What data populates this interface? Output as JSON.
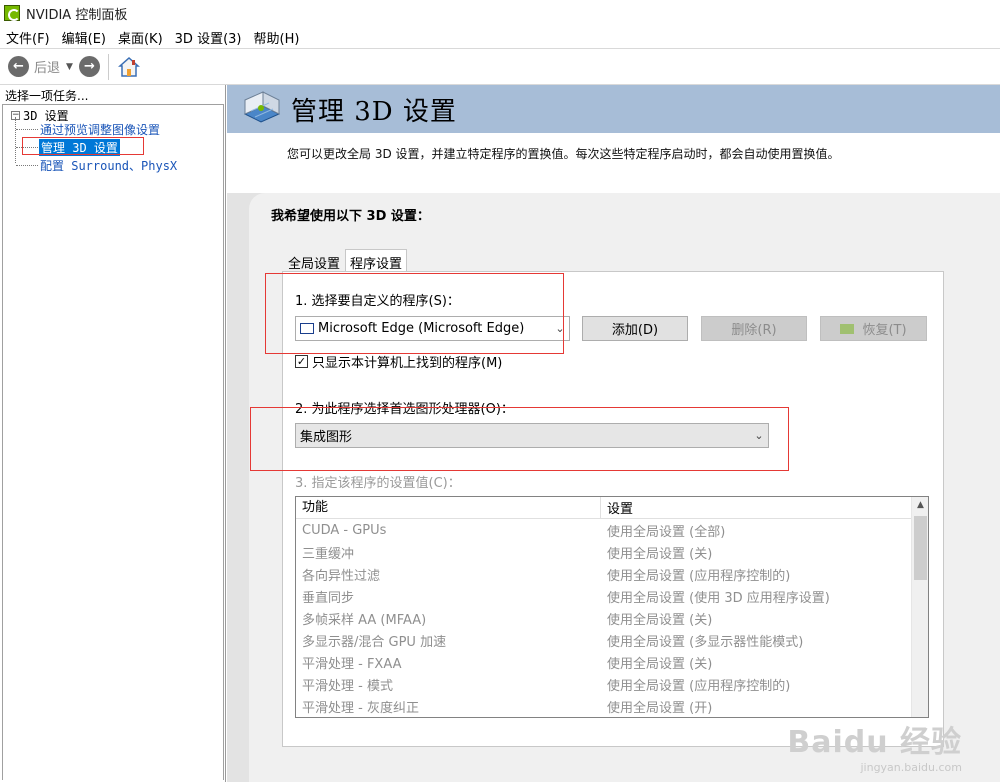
{
  "window": {
    "title": "NVIDIA 控制面板"
  },
  "menu": [
    "文件(F)",
    "编辑(E)",
    "桌面(K)",
    "3D 设置(3)",
    "帮助(H)"
  ],
  "toolbar": {
    "back_label": "后退"
  },
  "left": {
    "header": "选择一项任务...",
    "root": "3D 设置",
    "children": [
      "通过预览调整图像设置",
      "管理 3D 设置",
      "配置 Surround、PhysX"
    ]
  },
  "main": {
    "title": "管理 3D 设置",
    "description": "您可以更改全局 3D 设置，并建立特定程序的置换值。每次这些特定程序启动时，都会自动使用置换值。",
    "heading": "我希望使用以下 3D 设置：",
    "tabs": [
      "全局设置",
      "程序设置"
    ],
    "step1": {
      "label": "1. 选择要自定义的程序(S)：",
      "program": "Microsoft Edge (Microsoft Edge)",
      "add": "添加(D)",
      "remove": "删除(R)",
      "restore": "恢复(T)"
    },
    "checkbox": {
      "label": "只显示本计算机上找到的程序(M)",
      "checked": true,
      "mark": "✓"
    },
    "step2": {
      "label": "2. 为此程序选择首选图形处理器(O)：",
      "value": "集成图形"
    },
    "step3": {
      "label": "3. 指定该程序的设置值(C)：",
      "columns": [
        "功能",
        "设置"
      ],
      "rows": [
        [
          "CUDA - GPUs",
          "使用全局设置 (全部)"
        ],
        [
          "三重缓冲",
          "使用全局设置 (关)"
        ],
        [
          "各向异性过滤",
          "使用全局设置 (应用程序控制的)"
        ],
        [
          "垂直同步",
          "使用全局设置 (使用 3D 应用程序设置)"
        ],
        [
          "多帧采样 AA (MFAA)",
          "使用全局设置 (关)"
        ],
        [
          "多显示器/混合 GPU 加速",
          "使用全局设置 (多显示器性能模式)"
        ],
        [
          "平滑处理 - FXAA",
          "使用全局设置 (关)"
        ],
        [
          "平滑处理 - 模式",
          "使用全局设置 (应用程序控制的)"
        ],
        [
          "平滑处理 - 灰度纠正",
          "使用全局设置 (开)"
        ]
      ]
    }
  },
  "watermark": {
    "logo": "Baidu 经验",
    "url": "jingyan.baidu.com"
  }
}
